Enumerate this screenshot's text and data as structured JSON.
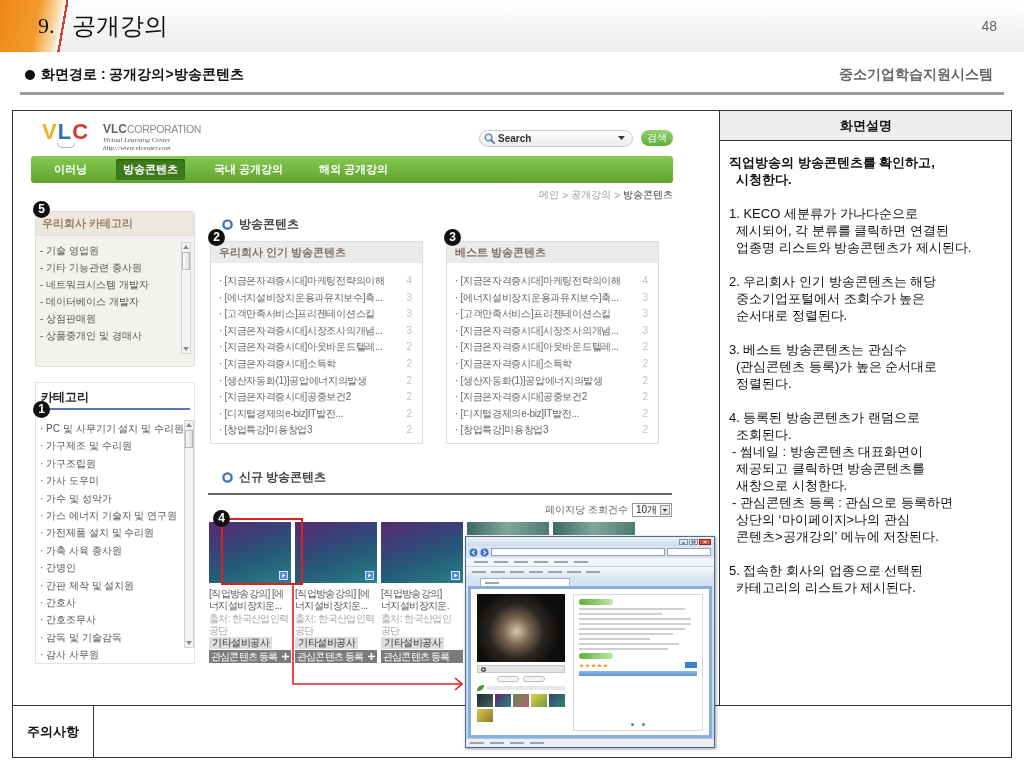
{
  "slide": {
    "section_number": "9.",
    "title": "공개강의",
    "page_number": "48"
  },
  "path": {
    "label": "화면경로 : 공개강의>방송콘텐츠",
    "system": "중소기업학습지원시스템"
  },
  "screen": {
    "logo": {
      "text": "VLC",
      "company": "**VLC**CORPORATION",
      "tagline": "Virtual Learning Center",
      "url": "http://www.vlcenter.com"
    },
    "search": {
      "value": "Search",
      "button": "검색"
    },
    "nav": [
      {
        "label": "이러닝",
        "selected": false
      },
      {
        "label": "방송콘텐츠",
        "selected": true
      },
      {
        "label": "국내 공개강의",
        "selected": false
      },
      {
        "label": "해외 공개강의",
        "selected": false
      }
    ],
    "breadcrumb": [
      {
        "label": "메인",
        "current": false,
        "separator": ">"
      },
      {
        "label": "공개강의",
        "current": false,
        "separator": ">"
      },
      {
        "label": "방송콘텐츠",
        "current": true
      }
    ],
    "company_categories": {
      "marker": "5",
      "title": "우리회사 카테고리",
      "items": [
        "- 기술 영업원",
        "- 기타 기능관련 종사원",
        "- 네트워크시스템 개발자",
        "- 데이터베이스 개발자",
        "- 상점판매원",
        "- 상품중개인 및 경매사"
      ]
    },
    "categories": {
      "marker": "1",
      "title": "카테고리",
      "items": [
        "· PC 및 사무기기 설치 및 수리원",
        "· 가구제조 및 수리원",
        "· 가구조립원",
        "· 가사 도우미",
        "· 가수 및 성악가",
        "· 가스 에너지 기술자 및 연구원",
        "· 가전제품 설치 및 수리원",
        "· 가축 사육 종사원",
        "· 간병인",
        "· 간판 제작 및 설치원",
        "· 간호사",
        "· 간호조무사",
        "· 감독 및 기술감독",
        "· 감사 사무원"
      ]
    },
    "broadcast": {
      "heading": "방송콘텐츠",
      "lists": [
        {
          "marker": "2",
          "title": "우리회사 인기 방송콘텐츠",
          "items": [
            {
              "title": "· [지금은자격증시대]마케팅전략의이해",
              "count": "4"
            },
            {
              "title": "· [에너지설비장치운용과유지보수]축...",
              "count": "3"
            },
            {
              "title": "· [고객만족서비스]프리젠테이션스킬",
              "count": "3"
            },
            {
              "title": "· [지금은자격증시대]시장조사의개념...",
              "count": "3"
            },
            {
              "title": "· [지금은자격증시대]아웃바운드텔레...",
              "count": "2"
            },
            {
              "title": "· [지금은자격증시대]소득학",
              "count": "2"
            },
            {
              "title": "· [생산자동화(1)]공압에너지의발생",
              "count": "2"
            },
            {
              "title": "· [지금은자격증시대]공중보건2",
              "count": "2"
            },
            {
              "title": "· [디지털경제의e-biz]IT발전...",
              "count": "2"
            },
            {
              "title": "· [창업특강]미용창업3",
              "count": "2"
            }
          ]
        },
        {
          "marker": "3",
          "title": "베스트 방송콘텐츠",
          "items": [
            {
              "title": "· [지금은자격증시대]마케팅전략의이해",
              "count": "4"
            },
            {
              "title": "· [에너지설비장치운용과유지보수]축...",
              "count": "3"
            },
            {
              "title": "· [고객만족서비스]프리젠테이션스킬",
              "count": "3"
            },
            {
              "title": "· [지금은자격증시대]시장조사의개념...",
              "count": "3"
            },
            {
              "title": "· [지금은자격증시대]아웃바운드텔레...",
              "count": "2"
            },
            {
              "title": "· [지금은자격증시대]소득학",
              "count": "2"
            },
            {
              "title": "· [생산자동화(1)]공압에너지의발생",
              "count": "2"
            },
            {
              "title": "· [지금은자격증시대]공중보건2",
              "count": "2"
            },
            {
              "title": "· [디지털경제의e-biz]IT발전...",
              "count": "2"
            },
            {
              "title": "· [창업특강]미용창업3",
              "count": "2"
            }
          ]
        }
      ]
    },
    "new_contents": {
      "heading": "신규 방송콘텐츠",
      "page_size_label": "페이지당 조회건수",
      "page_size": "10개",
      "marker": "4",
      "cards": [
        {
          "kind": "full",
          "highlighted": true,
          "title": "[직업방송강의] [에너지설비장치운...",
          "source": "출처: 한국산업인력 공단",
          "tag": "기타설비공사",
          "button": "관심콘텐츠 등록",
          "add_icon": true
        },
        {
          "kind": "full",
          "highlighted": false,
          "title": "[직업방송강의] [에너지설비장치운...",
          "source": "출처: 한국산업인력 공단",
          "tag": "기타설비공사",
          "button": "관심콘텐츠 등록",
          "add_icon": true
        },
        {
          "kind": "full",
          "highlighted": false,
          "title": "[직업방송강의]\n너지설비장치운.",
          "source": "출처: 한국산업인\n공단",
          "tag": "기타설비공사",
          "button": "관심콘텐츠 등록",
          "add_icon": false
        },
        {
          "kind": "partial",
          "highlighted": false
        },
        {
          "kind": "partial",
          "highlighted": false
        }
      ]
    },
    "popup": {
      "rating": {
        "stars": 5
      }
    }
  },
  "description": {
    "header": "화면설명",
    "lead": "직업방송의 방송콘텐츠를 확인하고,\n시청한다.",
    "items": [
      {
        "text": "1. KECO 세분류가 가나다순으로\n제시되어, 각 분류를 클릭하면 연결된\n업종명 리스트와 방송콘텐츠가 제시된다."
      },
      {
        "text": "2. 우리회사 인기 방송콘텐츠는 해당\n중소기업포털에서 조회수가 높은\n순서대로 정렬된다."
      },
      {
        "text": "3. 베스트 방송콘텐츠는 관심수\n(관심콘텐츠 등록)가 높은 순서대로\n정렬된다."
      },
      {
        "text": "4. 등록된 방송콘텐츠가 랜덤으로\n조회된다.",
        "notes": [
          "- 썸네일 : 방송콘텐츠 대표화면이\n제공되고 클릭하면 방송콘텐츠를\n새창으로 시청한다.",
          "- 관심콘텐츠 등록 : 관심으로 등록하면\n상단의 ‘마이페이지>나의 관심\n콘텐츠>공개강의’ 메뉴에 저장된다."
        ]
      },
      {
        "text": "5. 접속한 회사의 업종으로 선택된\n카테고리의 리스트가 제시된다."
      }
    ]
  },
  "notes": {
    "label": "주의사항"
  }
}
